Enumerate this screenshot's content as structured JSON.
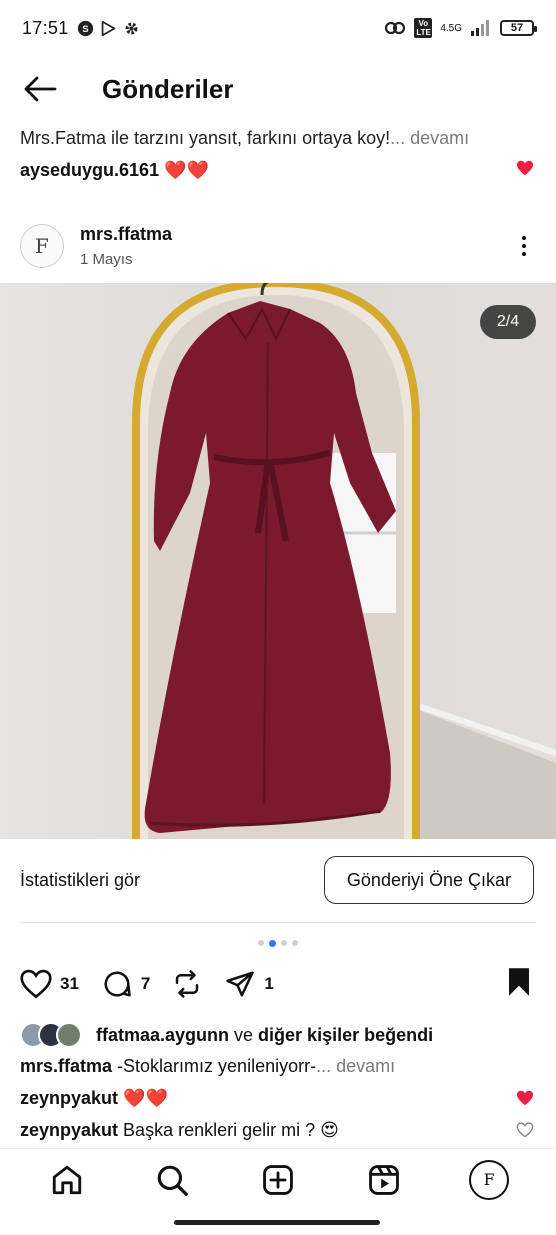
{
  "status_bar": {
    "time": "17:51",
    "network": "4.5G",
    "volte": "Vo LTE",
    "battery": "57"
  },
  "header": {
    "title": "Gönderiler"
  },
  "top_caption": {
    "text": "Mrs.Fatma ile tarzını yansıt, farkını ortaya koy!",
    "more": "... devamı"
  },
  "top_comment": {
    "user": "ayseduygu.6161",
    "emoji": "❤️❤️"
  },
  "post": {
    "user": "mrs.ffatma",
    "date": "1 Mayıs",
    "avatar_letter": "F",
    "image_counter": "2/4"
  },
  "buttons": {
    "stats": "İstatistikleri gör",
    "boost": "Gönderiyi Öne Çıkar"
  },
  "carousel": {
    "total": 4,
    "active": 2
  },
  "actions": {
    "likes": "31",
    "comments": "7",
    "shares": "1"
  },
  "liked_by": {
    "user": "ffatmaa.aygunn",
    "connector": " ve ",
    "others": "diğer kişiler beğendi"
  },
  "caption": {
    "user": "mrs.ffatma",
    "text": " -Stoklarımız yenileniyorr-",
    "more": "... devamı"
  },
  "comments": [
    {
      "user": "zeynpyakut",
      "text": " ❤️❤️",
      "liked": true
    },
    {
      "user": "zeynpyakut",
      "text": " Başka renkleri gelir mi ? 😍",
      "liked": false
    }
  ],
  "colors": {
    "accent_blue": "#3a73f0",
    "like_red": "#ed1d45",
    "dress": "#7a1a2c",
    "mirror_gold": "#d6aa2e"
  }
}
